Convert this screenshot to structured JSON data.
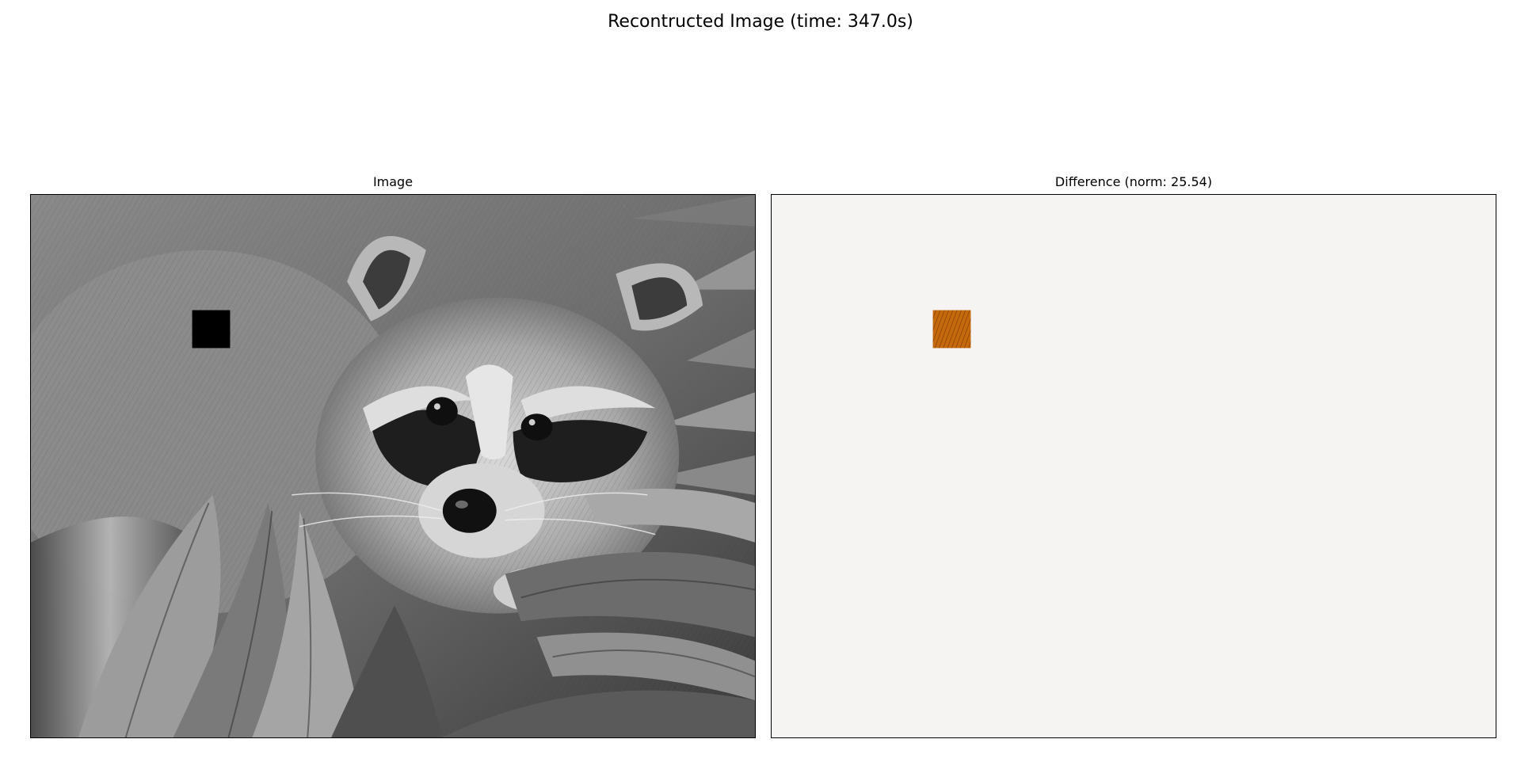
{
  "figure": {
    "suptitle": "Recontructed Image (time: 347.0s)"
  },
  "panels": [
    {
      "title": "Image",
      "content": "grayscale raccoon photo with black square patch",
      "patch_color": "#000000"
    },
    {
      "title": "Difference (norm: 25.54)",
      "content": "difference map, uniform background with orange square patch",
      "background_color": "#f5f4f2",
      "patch_color": "#b35806"
    }
  ]
}
